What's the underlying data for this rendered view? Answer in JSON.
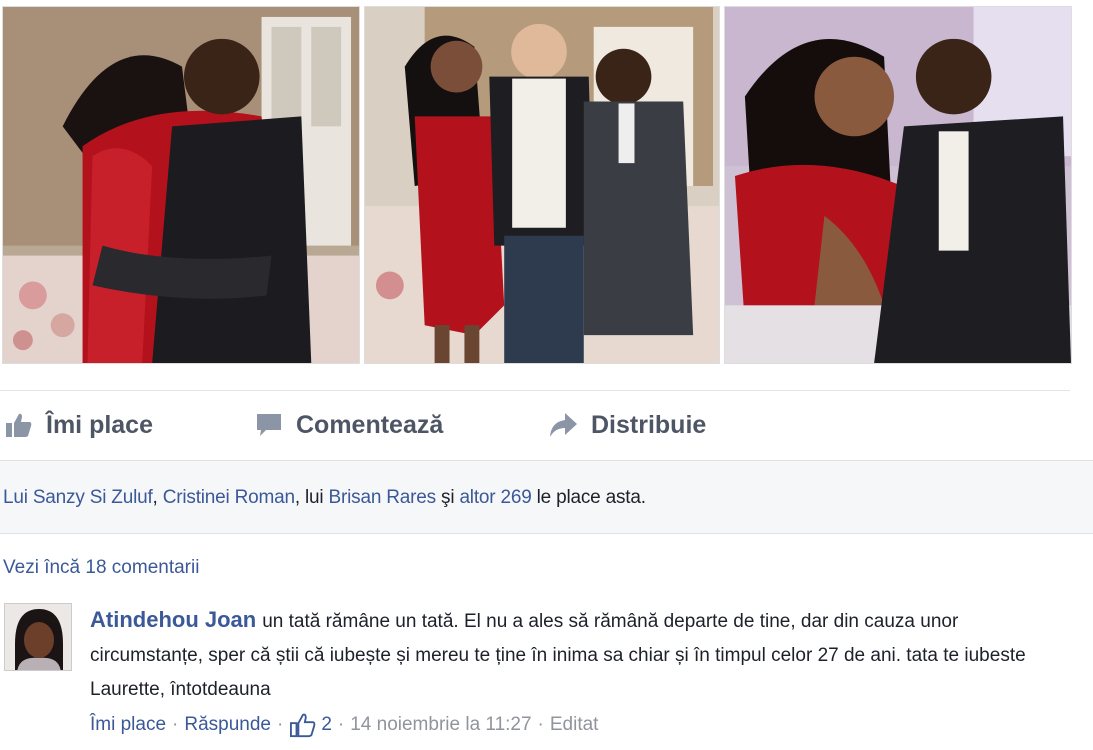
{
  "photos": [
    {
      "name": "photo-hug"
    },
    {
      "name": "photo-group"
    },
    {
      "name": "photo-kiss"
    }
  ],
  "actions": {
    "like_label": "Îmi place",
    "comment_label": "Comentează",
    "share_label": "Distribuie"
  },
  "likes": {
    "name1": "Lui Sanzy Si Zuluf",
    "sep1": ", ",
    "name2": "Cristinei Roman",
    "sep2": ", lui ",
    "name3": "Brisan Rares",
    "and_text": " şi ",
    "others": "altor 269",
    "suffix": " le place asta."
  },
  "view_more": "Vezi încă 18 comentarii",
  "comment": {
    "author": "Atindehou Joan",
    "text": "un tată rămâne un tată. El nu a ales să rămână departe de tine, dar din cauza unor circumstanțe, sper că știi că iubește și mereu te ține în inima sa chiar și în timpul celor 27 de ani. tata te iubeste Laurette, întotdeauna",
    "like_label": "Îmi place",
    "reply_label": "Răspunde",
    "like_count": "2",
    "timestamp": "14 noiembrie la 11:27",
    "edited_label": "Editat"
  },
  "colors": {
    "link": "#3b5998",
    "action_text": "#4e5665",
    "meta": "#90949c",
    "dress_red": "#b3121c"
  },
  "icons": {
    "like": "thumbs-up-icon",
    "comment": "speech-bubble-icon",
    "share": "share-arrow-icon"
  }
}
